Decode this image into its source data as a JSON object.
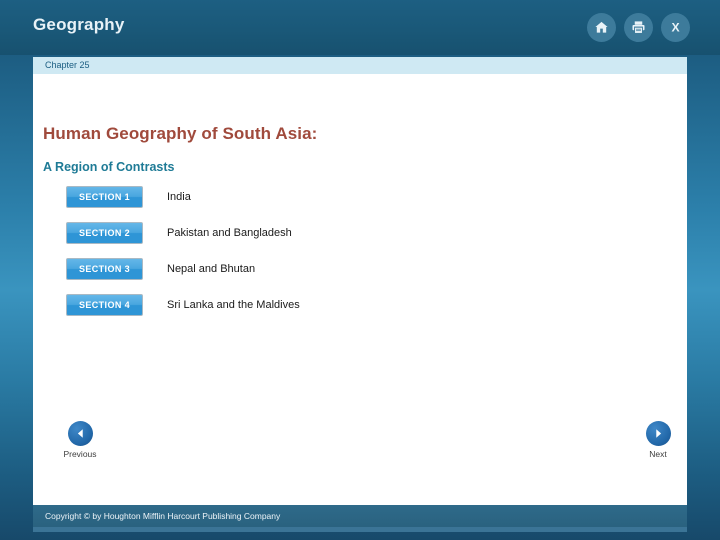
{
  "header": {
    "title": "Geography",
    "icons": [
      {
        "name": "home-icon",
        "label": "Home"
      },
      {
        "name": "print-icon",
        "label": "Print"
      },
      {
        "name": "close-icon",
        "label": "Close"
      }
    ]
  },
  "chapter": {
    "label": "Chapter 25"
  },
  "content": {
    "title": "Human Geography of South Asia:",
    "subtitle": "A Region of Contrasts",
    "sections": [
      {
        "button": "SECTION 1",
        "label": "India"
      },
      {
        "button": "SECTION 2",
        "label": "Pakistan and Bangladesh"
      },
      {
        "button": "SECTION 3",
        "label": "Nepal and Bhutan"
      },
      {
        "button": "SECTION 4",
        "label": "Sri Lanka and the Maldives"
      }
    ]
  },
  "navigation": {
    "previous_label": "Previous",
    "next_label": "Next"
  },
  "footer": {
    "copyright": "Copyright © by Houghton Mifflin Harcourt Publishing Company"
  },
  "colors": {
    "header_bg": "#1a5878",
    "chapter_bar_bg": "#cfe9f3",
    "title_color": "#a04a3c",
    "subtitle_color": "#1f7b96",
    "section_button_bg": "#2e95d6",
    "copyright_bg": "#2e6a8a"
  }
}
